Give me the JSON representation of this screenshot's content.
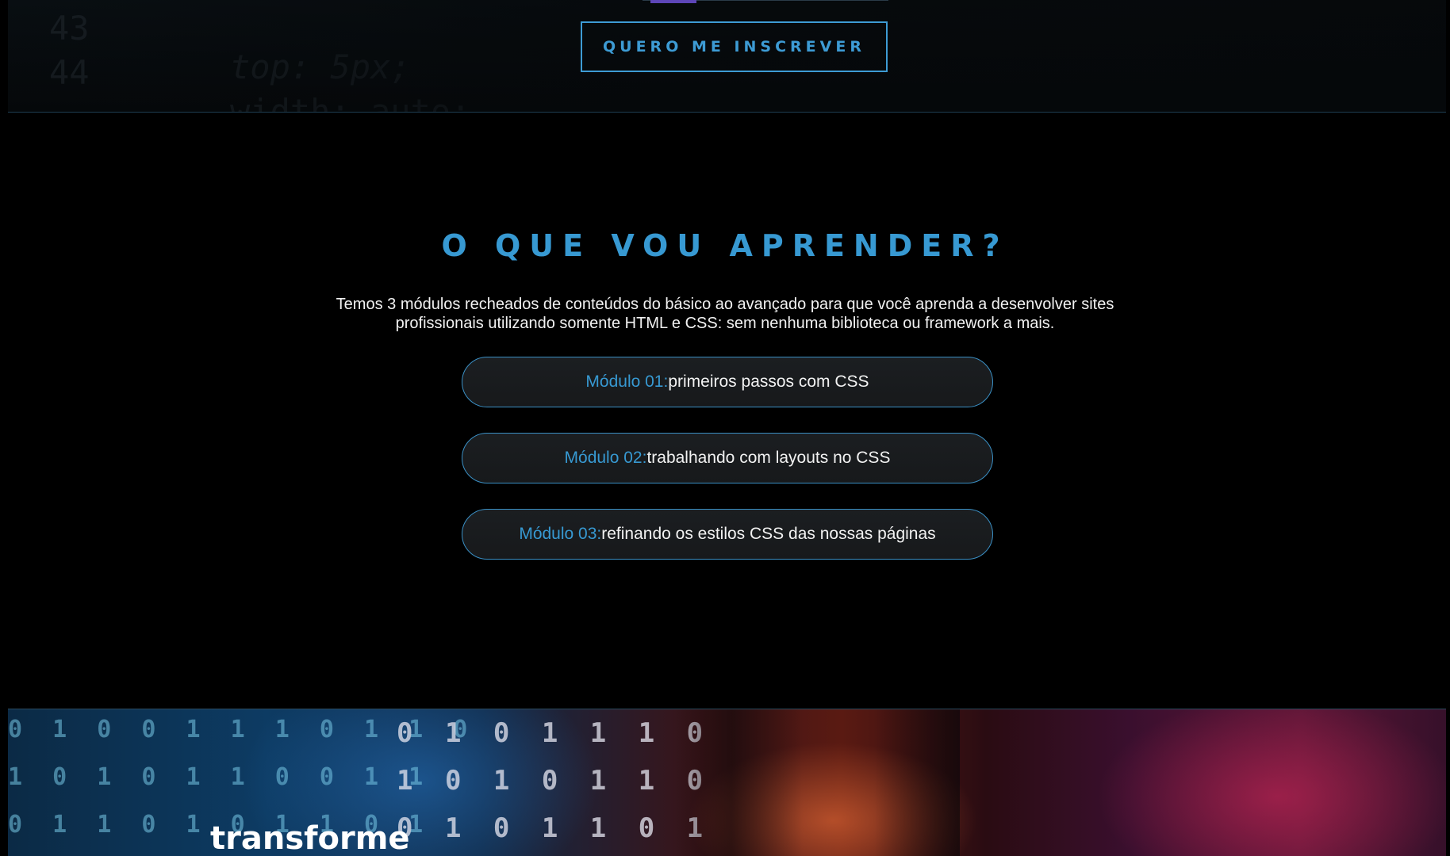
{
  "hero": {
    "code_lines": [
      {
        "num": "43",
        "code": "top: 5px;"
      },
      {
        "num": "44",
        "code": "width: auto;"
      }
    ],
    "cta_label": "QUERO ME INSCREVER"
  },
  "learn": {
    "title": "O QUE VOU APRENDER?",
    "description": "Temos 3 módulos recheados de conteúdos do básico ao avançado para que você aprenda a desenvolver sites profissionais utilizando somente HTML e CSS: sem nenhuma biblioteca ou framework a mais.",
    "modules": [
      {
        "label": "Módulo 01:",
        "text": "primeiros passos com CSS"
      },
      {
        "label": "Módulo 02:",
        "text": "trabalhando com layouts no CSS"
      },
      {
        "label": "Módulo 03:",
        "text": "refinando os estilos CSS das nossas páginas"
      }
    ]
  },
  "banner": {
    "title": "transforme",
    "binary_rows": [
      "0 1 0 1 1 1 0",
      "1 0 1 0 1 1 0",
      "0 1 0 1 1 0 1"
    ]
  },
  "colors": {
    "accent": "#3799d2",
    "background": "#000000",
    "module_bg": "#1b1e21",
    "text": "#f2f2f2"
  }
}
